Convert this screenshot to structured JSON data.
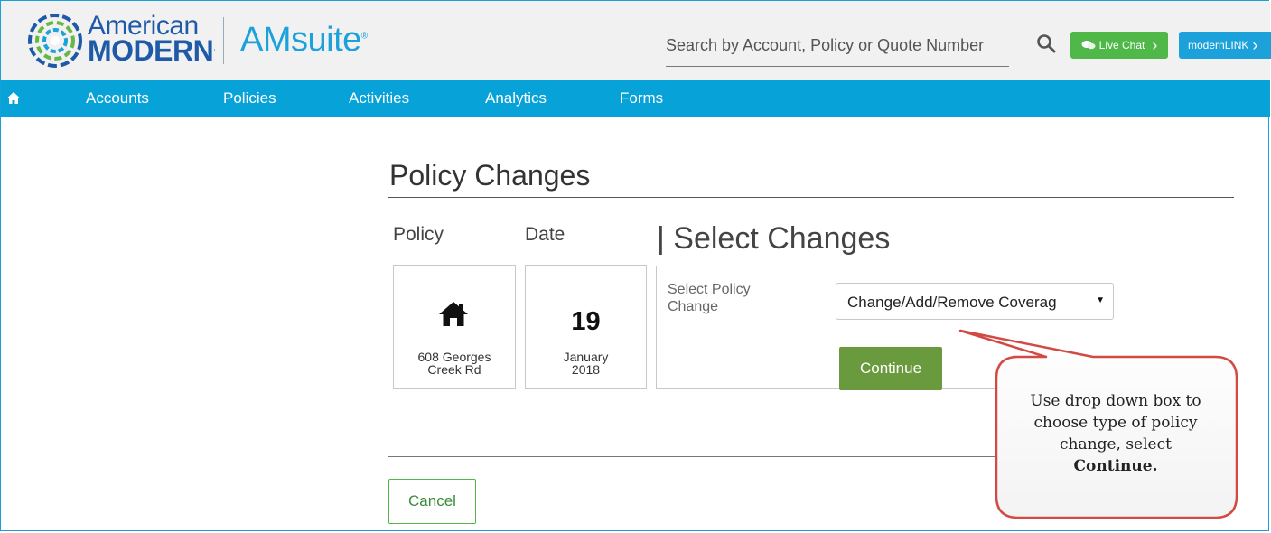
{
  "header": {
    "brand_top": "American",
    "brand_bottom": "MODERN",
    "suite_name": "AMsuite",
    "search_placeholder": "Search by Account, Policy or Quote Number",
    "live_chat_label": "Live Chat",
    "modernlink_label": "modernLINK"
  },
  "nav": {
    "items": [
      "Accounts",
      "Policies",
      "Activities",
      "Analytics",
      "Forms"
    ]
  },
  "page": {
    "title": "Policy Changes",
    "policy_label": "Policy",
    "date_label": "Date",
    "select_changes_title": "| Select Changes",
    "policy_address_line1": "608 Georges",
    "policy_address_line2": "Creek Rd",
    "date_day": "19",
    "date_month": "January",
    "date_year": "2018",
    "select_policy_change_label": "Select Policy Change",
    "select_value": "Change/Add/Remove Coverag",
    "continue_label": "Continue",
    "cancel_label": "Cancel"
  },
  "callout": {
    "line1": "Use drop down box to",
    "line2": "choose type of policy",
    "line3": "change, select",
    "line4": "Continue."
  },
  "colors": {
    "nav_blue": "#07a2d8",
    "brand_blue": "#1f5aa8",
    "continue_green": "#6a9a3e",
    "chat_green": "#4fb848",
    "callout_border": "#d24a43"
  }
}
